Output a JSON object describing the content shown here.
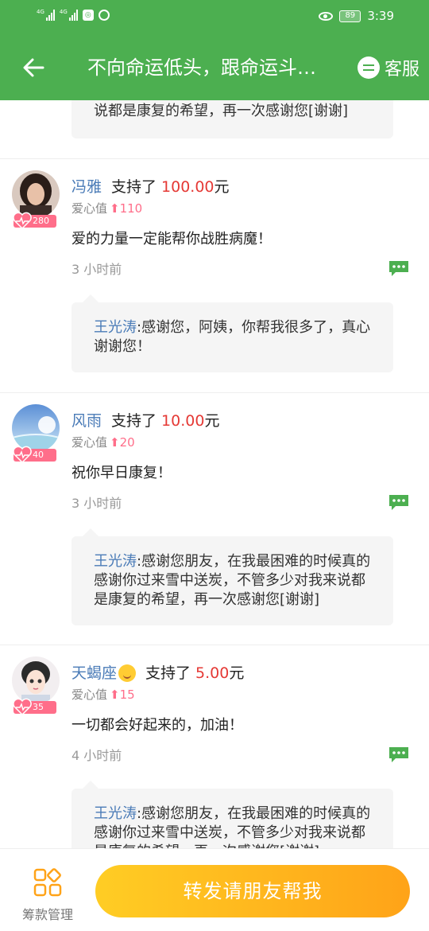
{
  "status_bar": {
    "network_1": "4G",
    "network_2": "4G",
    "battery": "89",
    "time": "3:39"
  },
  "app_bar": {
    "title": "不向命运低头，跟命运斗…",
    "service_label": "客服"
  },
  "top_reply": {
    "text": "说都是康复的希望，再一次感谢您[谢谢]"
  },
  "comments": [
    {
      "name": "冯雅",
      "verb": "支持了",
      "amount": "100.00",
      "unit": "元",
      "love_label": "爱心值",
      "love_value": "110",
      "badge": "280",
      "message": "爱的力量一定能帮你战胜病魔！",
      "time": "3 小时前",
      "reply_name": "王光涛",
      "reply_text": ":感谢您，阿姨，你帮我很多了，真心谢谢您！"
    },
    {
      "name": "风雨",
      "verb": "支持了",
      "amount": "10.00",
      "unit": "元",
      "love_label": "爱心值",
      "love_value": "20",
      "badge": "40",
      "message": "祝你早日康复！",
      "time": "3 小时前",
      "reply_name": "王光涛",
      "reply_text": ":感谢您朋友，在我最困难的时候真的感谢你过来雪中送炭，不管多少对我来说都是康复的希望，再一次感谢您[谢谢]"
    },
    {
      "name": "天蝎座",
      "verb": "支持了",
      "amount": "5.00",
      "unit": "元",
      "love_label": "爱心值",
      "love_value": "15",
      "badge": "35",
      "message": "一切都会好起来的，加油！",
      "time": "4 小时前",
      "reply_name": "王光涛",
      "reply_text": ":感谢您朋友，在我最困难的时候真的感谢你过来雪中送炭，不管多少对我来说都是康复的希望，再一次感谢您[谢谢]"
    }
  ],
  "bottom_bar": {
    "manage_label": "筹款管理",
    "share_label": "转发请朋友帮我"
  },
  "colors": {
    "brand_green": "#4caf50",
    "name_blue": "#4a7bb7",
    "amount_red": "#e53935",
    "love_pink": "#ff6e8a",
    "button_orange": "#ffa318"
  },
  "icons": {
    "back": "arrow-left-icon",
    "service": "chat-bubble-icon",
    "reply": "comment-icon",
    "manage": "grid-apps-icon",
    "love": "heart-pulse-icon"
  }
}
